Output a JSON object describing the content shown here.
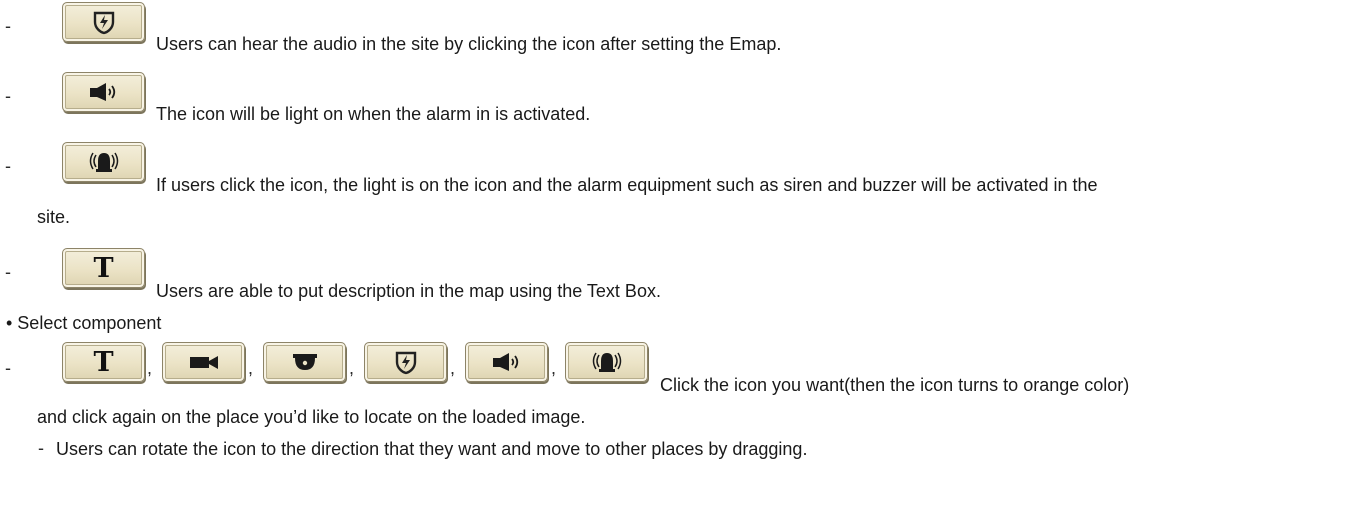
{
  "items": {
    "sound_desc": "Users can hear the audio in the site by clicking the icon after setting the Emap.",
    "alarm_in_desc": "The icon will be light on when the alarm in is activated.",
    "alarm_out_desc_line1": "If users click the icon, the light is on the icon and the alarm equipment such as siren and buzzer will be activated in the",
    "alarm_out_desc_line2": "site.",
    "textbox_desc": "Users are able to put description in the map using the Text Box."
  },
  "select_component": {
    "heading": "• Select component",
    "click_desc_line1": "Click the icon you want(then the icon turns to orange color)",
    "click_desc_line2": "and click again on the place you’d like to locate on the loaded image.",
    "rotate_desc": "Users can rotate the icon to the direction that they want and move to other places by dragging."
  },
  "glyphs": {
    "dash": "-",
    "comma": ",",
    "t_letter": "T"
  },
  "icons": [
    "sensor-icon",
    "speaker-icon",
    "siren-icon",
    "text-box-icon",
    "camera-icon",
    "dome-camera-icon"
  ],
  "colors": {
    "button_face": "#ebe3c6",
    "text": "#1a1a1a"
  }
}
